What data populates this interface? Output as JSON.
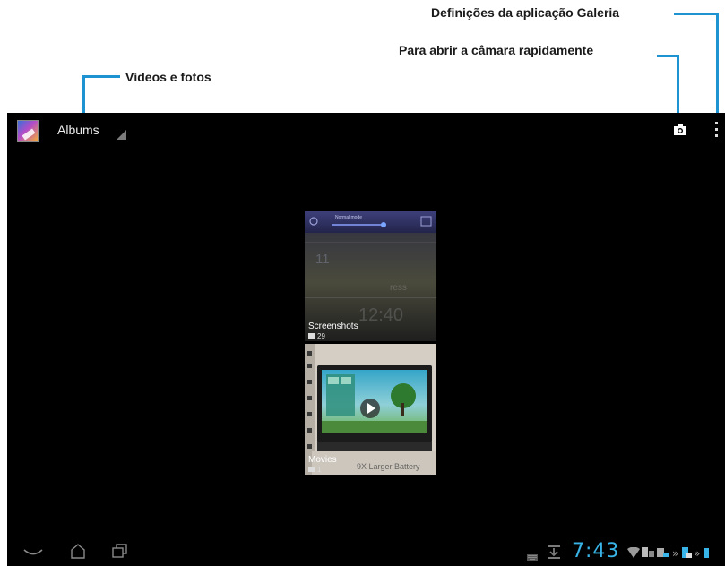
{
  "annotations": {
    "gallery_settings": "Definições da aplicação Galeria",
    "quick_camera": "Para abrir a câmara rapidamente",
    "videos_photos": "Vídeos e fotos"
  },
  "action_bar": {
    "album_selector_label": "Albums"
  },
  "albums": [
    {
      "name": "Screenshots",
      "count": "29"
    },
    {
      "name": "Movies",
      "count": "1"
    }
  ],
  "screenshot_thumb": {
    "mode_label": "Normal mode"
  },
  "status_bar": {
    "clock": "7:43"
  },
  "colors": {
    "leader_line": "#1d93d1",
    "clock": "#39b4e8",
    "screen_bg": "#000000"
  },
  "icons": [
    "gallery-app-icon",
    "camera-icon",
    "overflow-menu-icon",
    "back-icon",
    "home-icon",
    "recent-apps-icon",
    "keyboard-icon",
    "download-icon",
    "wifi-icon",
    "battery-icon"
  ]
}
